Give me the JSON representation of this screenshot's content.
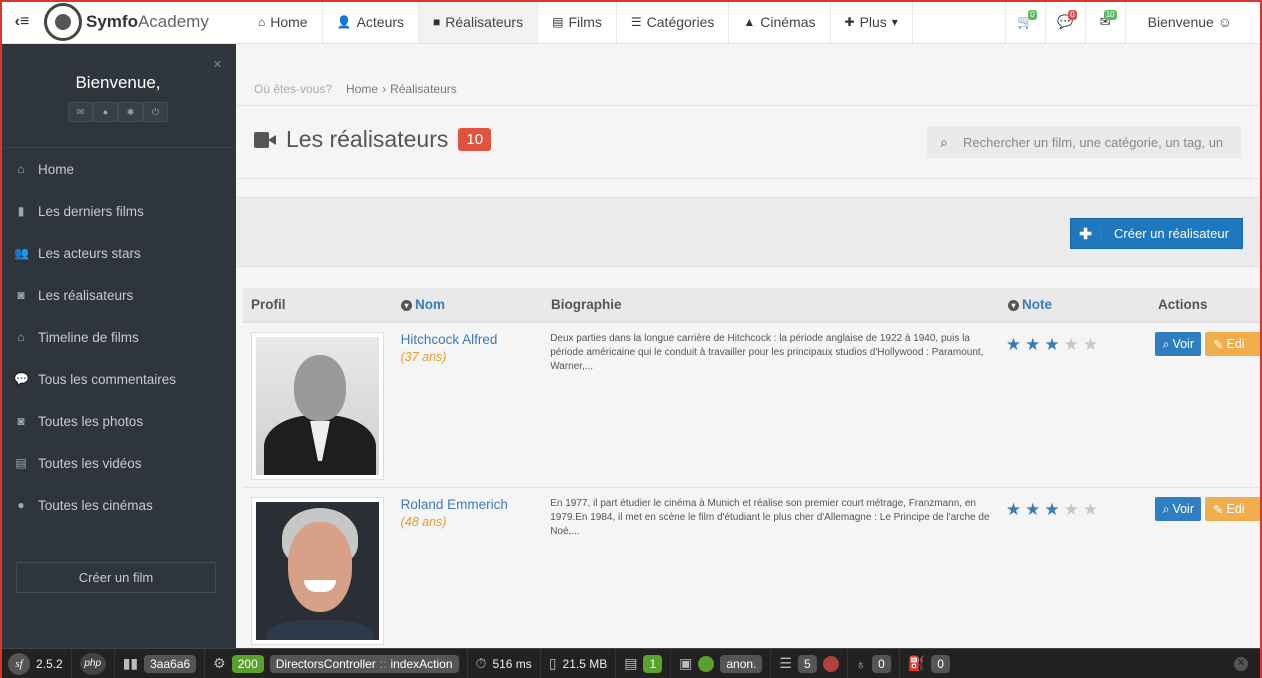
{
  "topbar": {
    "brand_bold": "Symfo",
    "brand_rest": "Academy",
    "nav": [
      {
        "label": "Home"
      },
      {
        "label": "Acteurs"
      },
      {
        "label": "Réalisateurs"
      },
      {
        "label": "Films"
      },
      {
        "label": "Catégories"
      },
      {
        "label": "Cinémas"
      },
      {
        "label": "Plus"
      }
    ],
    "cart_count": "0",
    "comments_count": "0",
    "messages_count": "10",
    "welcome": "Bienvenue ☺"
  },
  "sidebar": {
    "welcome": "Bienvenue,",
    "items": [
      {
        "label": "Home",
        "icon": "home-icon"
      },
      {
        "label": "Les derniers films",
        "icon": "bookmark-icon"
      },
      {
        "label": "Les acteurs stars",
        "icon": "users-icon"
      },
      {
        "label": "Les réalisateurs",
        "icon": "camera-icon"
      },
      {
        "label": "Timeline de films",
        "icon": "home-icon"
      },
      {
        "label": "Tous les commentaires",
        "icon": "comments-icon"
      },
      {
        "label": "Toutes les photos",
        "icon": "camera-icon"
      },
      {
        "label": "Toutes les vidéos",
        "icon": "film-icon"
      },
      {
        "label": "Toutes les cinémas",
        "icon": "map-marker-icon"
      }
    ],
    "create_film": "Créer un film"
  },
  "main": {
    "breadcrumb": {
      "prefix": "Où êtes-vous?",
      "home": "Home",
      "current": "Réalisateurs"
    },
    "title": "Les réalisateurs",
    "count": "10",
    "search_placeholder": "Rechercher un film, une catégorie, un tag, un",
    "create_button": "Créer un réalisateur",
    "columns": {
      "profil": "Profil",
      "nom": "Nom",
      "bio": "Biographie",
      "note": "Note",
      "actions": "Actions"
    },
    "rows": [
      {
        "name": "Hitchcock Alfred",
        "age": "(37 ans)",
        "bio": "Deux parties dans la longue carrière de Hitchcock : la période anglaise de 1922 à 1940, puis la période américaine qui le conduit à travailler pour les principaux studios d'Hollywood : Paramount, Warner,...",
        "rating": 3,
        "rating_max": 5,
        "voir": "Voir",
        "edit": "Edi"
      },
      {
        "name": "Roland Emmerich",
        "age": "(48 ans)",
        "bio": "En 1977, il part étudier le cinéma à Munich et réalise son premier court métrage, Franzmann, en 1979.En 1984, il met en scène le film d'étudiant le plus cher d'Allemagne : Le Principe de l'arche de Noé,...",
        "rating": 3,
        "rating_max": 5,
        "voir": "Voir",
        "edit": "Edi"
      }
    ]
  },
  "debug": {
    "version": "2.5.2",
    "php": "php",
    "token": "3aa6a6",
    "status": "200",
    "controller": "DirectorsController",
    "action": "indexAction",
    "time": "516 ms",
    "memory": "21.5 MB",
    "logs": "1",
    "user": "anon.",
    "queries": "5",
    "security": "0",
    "events": "0"
  },
  "colors": {
    "accent": "#3b7bb8",
    "badge": "#e0533f",
    "sidebar": "#2f353c",
    "create": "#1f77be",
    "edit": "#f0ad4e"
  }
}
